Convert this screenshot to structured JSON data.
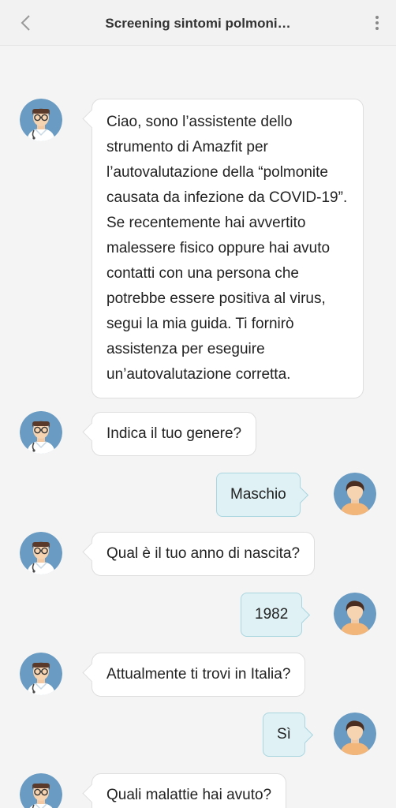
{
  "header": {
    "title": "Screening sintomi polmoni…",
    "back_icon": "chevron-left-icon",
    "more_icon": "more-vertical-icon"
  },
  "colors": {
    "background": "#f4f4f4",
    "bot_bubble": "#ffffff",
    "user_bubble": "#dff1f5",
    "user_bubble_border": "#a9d6df",
    "avatar_bg": "#6a9bc2"
  },
  "messages": [
    {
      "sender": "bot",
      "text": "Ciao, sono l’assistente dello strumento di Amazfit per l’autovalutazione della “polmonite causata da infezione da COVID-19”. Se recentemente hai avvertito malessere fisico oppure hai avuto contatti con una persona che potrebbe essere positiva al virus, segui la mia guida. Ti fornirò assistenza per eseguire un’autovalutazione corretta."
    },
    {
      "sender": "bot",
      "text": "Indica il tuo genere?"
    },
    {
      "sender": "user",
      "text": "Maschio"
    },
    {
      "sender": "bot",
      "text": "Qual è il tuo anno di nascita?"
    },
    {
      "sender": "user",
      "text": "1982"
    },
    {
      "sender": "bot",
      "text": "Attualmente ti trovi in Italia?"
    },
    {
      "sender": "user",
      "text": "Sì"
    },
    {
      "sender": "bot",
      "text": "Quali malattie hai avuto?"
    }
  ]
}
